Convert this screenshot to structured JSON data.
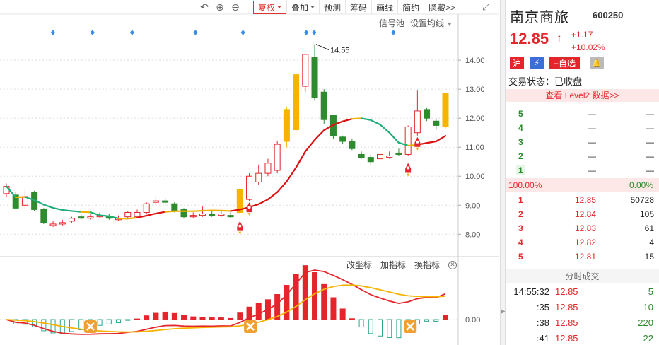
{
  "toolbar": {
    "undo_icon": "undo-icon",
    "zoom_in_icon": "zoom-in-icon",
    "zoom_out_icon": "zoom-out-icon",
    "buttons": [
      "复权",
      "叠加",
      "预测",
      "筹码",
      "画线",
      "简约",
      "隐藏>>"
    ],
    "expand_icon": "expand-icon"
  },
  "signal_links": {
    "signal_pool": "信号池",
    "set_ma": "设置均线"
  },
  "sub_links": {
    "coord": "改坐标",
    "add": "加指标",
    "swap": "换指标"
  },
  "kline_peak_label": "14.55",
  "chart_data": {
    "type": "candlestick",
    "y_ticks": [
      "14.00",
      "13.00",
      "12.00",
      "11.00",
      "10.00",
      "9.00",
      "8.00"
    ],
    "ylim": [
      7.3,
      15.1
    ],
    "peak_annotation": "14.55",
    "candles": [
      [
        9.4,
        9.65,
        9.75,
        9.3
      ],
      [
        9.35,
        8.9,
        9.45,
        8.85
      ],
      [
        9.0,
        9.3,
        9.55,
        8.9
      ],
      [
        9.45,
        8.85,
        9.5,
        8.8
      ],
      [
        8.85,
        8.4,
        8.9,
        8.35
      ],
      [
        8.3,
        8.35,
        8.45,
        8.25
      ],
      [
        8.35,
        8.4,
        8.5,
        8.3
      ],
      [
        8.45,
        8.55,
        8.6,
        8.4
      ],
      [
        8.6,
        8.55,
        8.7,
        8.5
      ],
      [
        8.55,
        8.6,
        8.7,
        8.5
      ],
      [
        8.6,
        8.65,
        8.75,
        8.55
      ],
      [
        8.6,
        8.55,
        8.7,
        8.5
      ],
      [
        8.5,
        8.55,
        8.65,
        8.45
      ],
      [
        8.6,
        8.75,
        8.8,
        8.55
      ],
      [
        8.6,
        8.75,
        8.85,
        8.55
      ],
      [
        8.75,
        9.05,
        9.1,
        8.7
      ],
      [
        9.1,
        9.15,
        9.3,
        9.0
      ],
      [
        9.15,
        9.1,
        9.25,
        9.0
      ],
      [
        9.05,
        8.8,
        9.1,
        8.75
      ],
      [
        8.85,
        8.6,
        8.9,
        8.55
      ],
      [
        8.6,
        8.65,
        8.75,
        8.55
      ],
      [
        8.65,
        8.7,
        8.95,
        8.6
      ],
      [
        8.7,
        8.65,
        8.8,
        8.6
      ],
      [
        8.65,
        8.7,
        8.8,
        8.6
      ],
      [
        8.65,
        8.6,
        8.75,
        8.55
      ],
      [
        8.75,
        9.55,
        9.55,
        8.7
      ],
      [
        9.2,
        10.0,
        10.1,
        9.15
      ],
      [
        9.8,
        10.1,
        10.4,
        9.7
      ],
      [
        10.1,
        10.45,
        10.6,
        10.0
      ],
      [
        10.2,
        11.1,
        11.2,
        10.1
      ],
      [
        11.2,
        12.3,
        12.4,
        11.0
      ],
      [
        11.6,
        13.5,
        13.6,
        11.5
      ],
      [
        13.1,
        14.2,
        14.2,
        12.9
      ],
      [
        14.1,
        12.7,
        14.55,
        12.6
      ],
      [
        12.9,
        11.95,
        13.0,
        11.8
      ],
      [
        12.1,
        11.4,
        12.1,
        11.3
      ],
      [
        11.35,
        11.2,
        11.4,
        11.1
      ],
      [
        11.2,
        10.95,
        11.3,
        10.9
      ],
      [
        10.75,
        10.65,
        10.85,
        10.6
      ],
      [
        10.65,
        10.5,
        10.75,
        10.4
      ],
      [
        10.6,
        10.75,
        10.9,
        10.55
      ],
      [
        10.65,
        10.7,
        10.85,
        10.6
      ],
      [
        10.8,
        10.75,
        10.95,
        10.7
      ],
      [
        10.75,
        11.7,
        11.75,
        10.7
      ],
      [
        11.5,
        12.25,
        12.95,
        11.4
      ],
      [
        12.3,
        12.0,
        12.35,
        11.9
      ],
      [
        11.9,
        11.75,
        12.0,
        11.6
      ],
      [
        11.7,
        12.85,
        12.85,
        11.65
      ]
    ]
  },
  "sub_chart": {
    "zero_label": "0.00"
  },
  "panel": {
    "name": "南京商旅",
    "code": "600250",
    "price": "12.85",
    "change_abs": "+1.17",
    "change_pct": "+10.02%",
    "badge_hu": "沪",
    "badge_add": "+自选",
    "trade_status": "交易状态：已收盘",
    "level2": "查看 Level2 数据>>",
    "sell_levels": [
      {
        "lvl": "5",
        "price": "—",
        "vol": "—"
      },
      {
        "lvl": "4",
        "price": "—",
        "vol": "—"
      },
      {
        "lvl": "3",
        "price": "—",
        "vol": "—"
      },
      {
        "lvl": "2",
        "price": "—",
        "vol": "—"
      },
      {
        "lvl": "1",
        "price": "—",
        "vol": "—"
      }
    ],
    "ratio_left": "100.00%",
    "ratio_right": "0.00%",
    "buy_levels": [
      {
        "lvl": "1",
        "price": "12.85",
        "vol": "50728"
      },
      {
        "lvl": "2",
        "price": "12.84",
        "vol": "105"
      },
      {
        "lvl": "3",
        "price": "12.83",
        "vol": "61"
      },
      {
        "lvl": "4",
        "price": "12.82",
        "vol": "4"
      },
      {
        "lvl": "5",
        "price": "12.81",
        "vol": "15"
      }
    ],
    "tick_title": "分时成交",
    "ticks": [
      {
        "time": "14:55:32",
        "price": "12.85",
        "vol": "5"
      },
      {
        "time": ":35",
        "price": "12.85",
        "vol": "10"
      },
      {
        "time": ":38",
        "price": "12.85",
        "vol": "220"
      },
      {
        "time": ":41",
        "price": "12.85",
        "vol": "22"
      }
    ]
  }
}
